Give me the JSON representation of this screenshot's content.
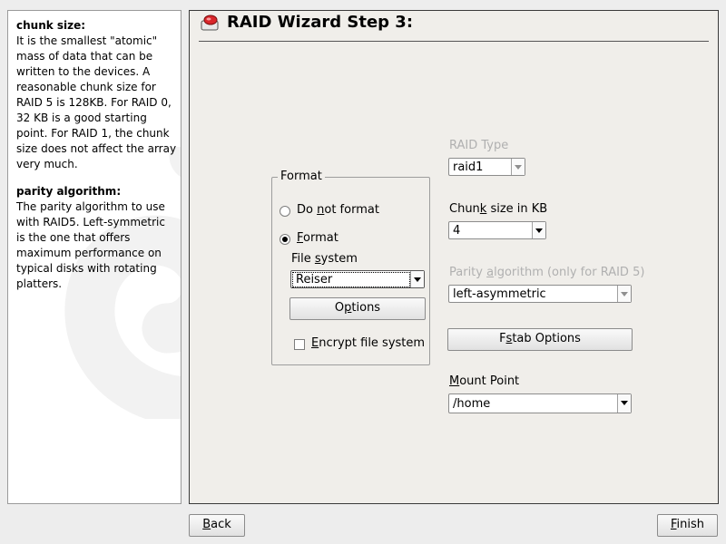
{
  "help": {
    "section1_title": "chunk size:",
    "section1_text": "It is the smallest \"atomic\" mass of data that can be written to the devices. A reasonable chunk size for RAID 5 is 128KB. For RAID 0, 32 KB is a good starting point. For RAID 1, the chunk size does not affect the array very much.",
    "section2_title": "parity algorithm:",
    "section2_text": "The parity algorithm to use with RAID5. Left-symmetric is the one that offers maximum performance on typical disks with rotating platters."
  },
  "header": {
    "title": "RAID Wizard Step 3:"
  },
  "format_group": {
    "legend": "Format",
    "do_not_format": {
      "pre": "Do ",
      "u": "n",
      "post": "ot format"
    },
    "format": {
      "pre": "",
      "u": "F",
      "post": "ormat"
    },
    "file_system_label": {
      "pre": "File ",
      "u": "s",
      "post": "ystem"
    },
    "file_system_value": "Reiser",
    "options_button": {
      "pre": "O",
      "u": "p",
      "post": "tions"
    },
    "encrypt": {
      "pre": "",
      "u": "E",
      "post": "ncrypt file system"
    },
    "selected": "format",
    "encrypt_checked": false
  },
  "raid": {
    "type_label": "RAID Type",
    "type_value": "raid1",
    "chunk_label": {
      "pre": "Chun",
      "u": "k",
      "post": " size in KB"
    },
    "chunk_value": "4",
    "parity_label": {
      "pre": "Parity ",
      "u": "a",
      "post": "lgorithm (only for RAID 5)"
    },
    "parity_value": "left-asymmetric",
    "fstab_button": {
      "pre": "F",
      "u": "s",
      "post": "tab Options"
    },
    "mount_label": {
      "pre": "",
      "u": "M",
      "post": "ount Point"
    },
    "mount_value": "/home"
  },
  "footer": {
    "back": {
      "pre": "",
      "u": "B",
      "post": "ack"
    },
    "finish": {
      "pre": "",
      "u": "F",
      "post": "inish"
    }
  },
  "colors": {
    "background": "#ededed",
    "panel": "#f0eeea",
    "disabled_text": "#b0b0b0",
    "icon_red": "#d9262b"
  }
}
